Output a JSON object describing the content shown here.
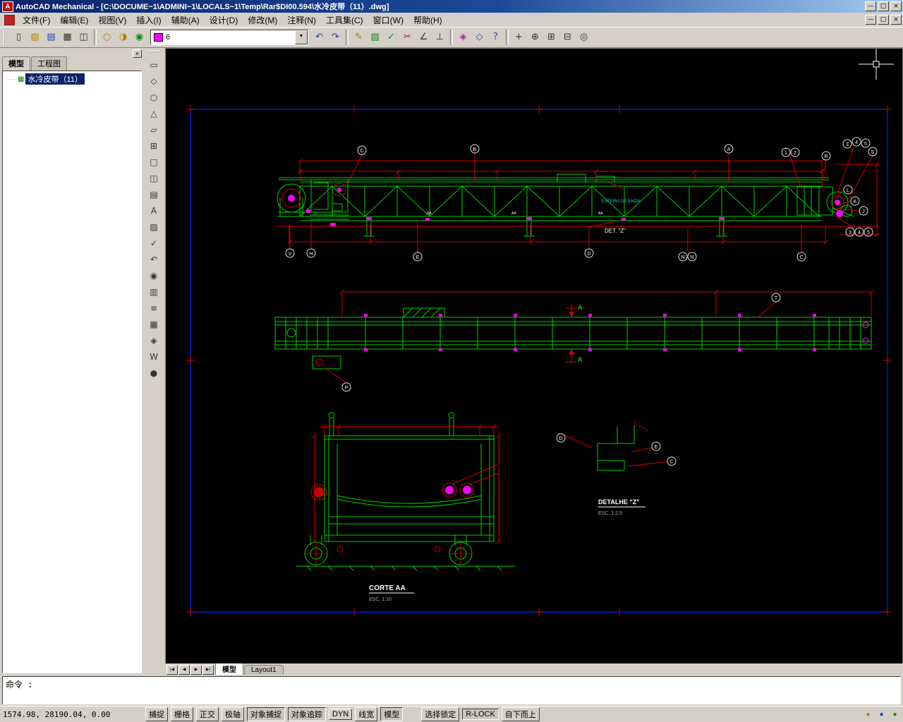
{
  "window": {
    "title": "AutoCAD Mechanical - [C:\\DOCUME~1\\ADMINI~1\\LOCALS~1\\Temp\\Rar$DI00.594\\水冷皮带（11）.dwg]",
    "app_icon": "A",
    "buttons": {
      "minimize": "—",
      "restore": "□",
      "close": "×"
    }
  },
  "menubar": {
    "items": [
      "文件(F)",
      "编辑(E)",
      "视图(V)",
      "插入(I)",
      "辅助(A)",
      "设计(D)",
      "修改(M)",
      "注释(N)",
      "工具集(C)",
      "窗口(W)",
      "帮助(H)"
    ]
  },
  "toolbar": {
    "layer_value": "6",
    "combo_arrow": "▼",
    "icons": [
      "▯",
      "▨",
      "▤",
      "▦",
      "◫",
      "○",
      "◑",
      "◉",
      "↶",
      "↷",
      "✎",
      "▧",
      "✓",
      "✂",
      "∠",
      "⊥",
      "◈",
      "◇",
      "?",
      "+",
      "⊕",
      "⊞",
      "⊟",
      "◎"
    ]
  },
  "vtoolbar": {
    "icons": [
      "▭",
      "◇",
      "○",
      "△",
      "▱",
      "⊞",
      "□",
      "◫",
      "▤",
      "A",
      "▨",
      "✓",
      "↶",
      "◉",
      "▥",
      "≡",
      "▦",
      "◈",
      "W",
      "●"
    ]
  },
  "palette": {
    "tabs": [
      "模型",
      "工程图"
    ],
    "tree_item": "水冷皮带（11）",
    "close_glyph": "×"
  },
  "drawing": {
    "labels": {
      "det_z": "DET. \"Z\"",
      "corte_title": "CORTE AA",
      "corte_scale": "ESC. 1:10",
      "detalhe_title": "DETALHE \"Z\"",
      "detalhe_scale": "ESC. 1:2.5",
      "belt_note": "ESTEIRA DA SAIDA",
      "section_marker": "A",
      "aa_mark": "AA",
      "f_mark": "F"
    },
    "balloons": [
      "C",
      "B",
      "A",
      "1",
      "2",
      "R",
      "3",
      "4",
      "5",
      "S",
      "L",
      "K",
      "J",
      "3",
      "4",
      "5",
      "V",
      "H",
      "E",
      "D",
      "N",
      "N",
      "C",
      "T",
      "P",
      "D",
      "E",
      "C"
    ]
  },
  "layout_bar": {
    "nav": [
      "|◀",
      "◀",
      "▶",
      "▶|"
    ],
    "tabs": [
      "模型",
      "Layout1"
    ]
  },
  "command": {
    "prompt": "命令 :"
  },
  "statusbar": {
    "coords": "1574.98,  28190.04, 0.00",
    "toggles": [
      "捕捉",
      "栅格",
      "正交",
      "极轴",
      "对象捕捉",
      "对象追踪",
      "DYN",
      "线宽",
      "模型"
    ],
    "right": [
      "选择锁定",
      "R-LOCK",
      "自下而上"
    ],
    "tray": [
      "●",
      "●",
      "●"
    ]
  }
}
